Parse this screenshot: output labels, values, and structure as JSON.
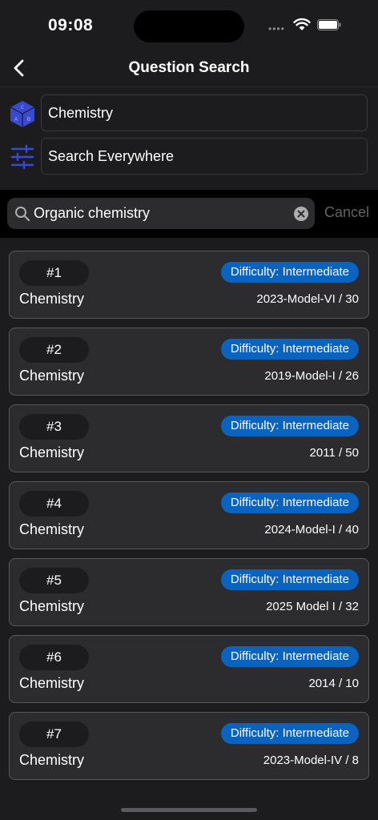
{
  "status": {
    "time": "09:08",
    "signal": "••••"
  },
  "nav": {
    "title": "Question Search"
  },
  "filters": {
    "subject": "Chemistry",
    "scope": "Search Everywhere"
  },
  "search": {
    "query": "Organic chemistry",
    "cancel_label": "Cancel"
  },
  "results": [
    {
      "number": "#1",
      "difficulty": "Difficulty: Intermediate",
      "subject": "Chemistry",
      "source": "2023-Model-VI / 30"
    },
    {
      "number": "#2",
      "difficulty": "Difficulty: Intermediate",
      "subject": "Chemistry",
      "source": "2019-Model-I / 26"
    },
    {
      "number": "#3",
      "difficulty": "Difficulty: Intermediate",
      "subject": "Chemistry",
      "source": "2011 / 50"
    },
    {
      "number": "#4",
      "difficulty": "Difficulty: Intermediate",
      "subject": "Chemistry",
      "source": "2024-Model-I / 40"
    },
    {
      "number": "#5",
      "difficulty": "Difficulty: Intermediate",
      "subject": "Chemistry",
      "source": "2025 Model I / 32"
    },
    {
      "number": "#6",
      "difficulty": "Difficulty: Intermediate",
      "subject": "Chemistry",
      "source": "2014 / 10"
    },
    {
      "number": "#7",
      "difficulty": "Difficulty: Intermediate",
      "subject": "Chemistry",
      "source": "2023-Model-IV / 8"
    }
  ],
  "colors": {
    "accent": "#0a63bf",
    "background": "#1c1c1e",
    "card": "#2c2c2e",
    "icon": "#3a4ad0"
  }
}
